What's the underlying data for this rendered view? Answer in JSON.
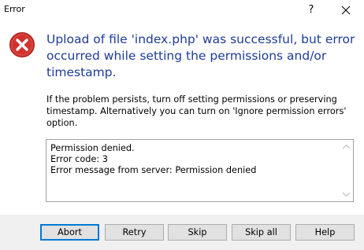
{
  "window": {
    "title": "Error",
    "help_glyph": "?",
    "close_icon": "close-icon"
  },
  "icon": "error-icon",
  "main_instruction": "Upload of file 'index.php' was successful, but error occurred while setting the permissions and/or timestamp.",
  "content": "If the problem persists, turn off setting permissions or preserving timestamp. Alternatively you can turn on 'Ignore permission errors' option.",
  "message_box": {
    "lines": [
      "Permission denied.",
      "Error code: 3",
      "Error message from server: Permission denied"
    ]
  },
  "buttons": {
    "abort": "Abort",
    "retry": "Retry",
    "skip": "Skip",
    "skip_all": "Skip all",
    "help": "Help"
  },
  "colors": {
    "instruction": "#1e3c96",
    "error_red": "#d1342f",
    "default_button_border": "#0078d7",
    "footer_bg": "#f0f0f0"
  }
}
